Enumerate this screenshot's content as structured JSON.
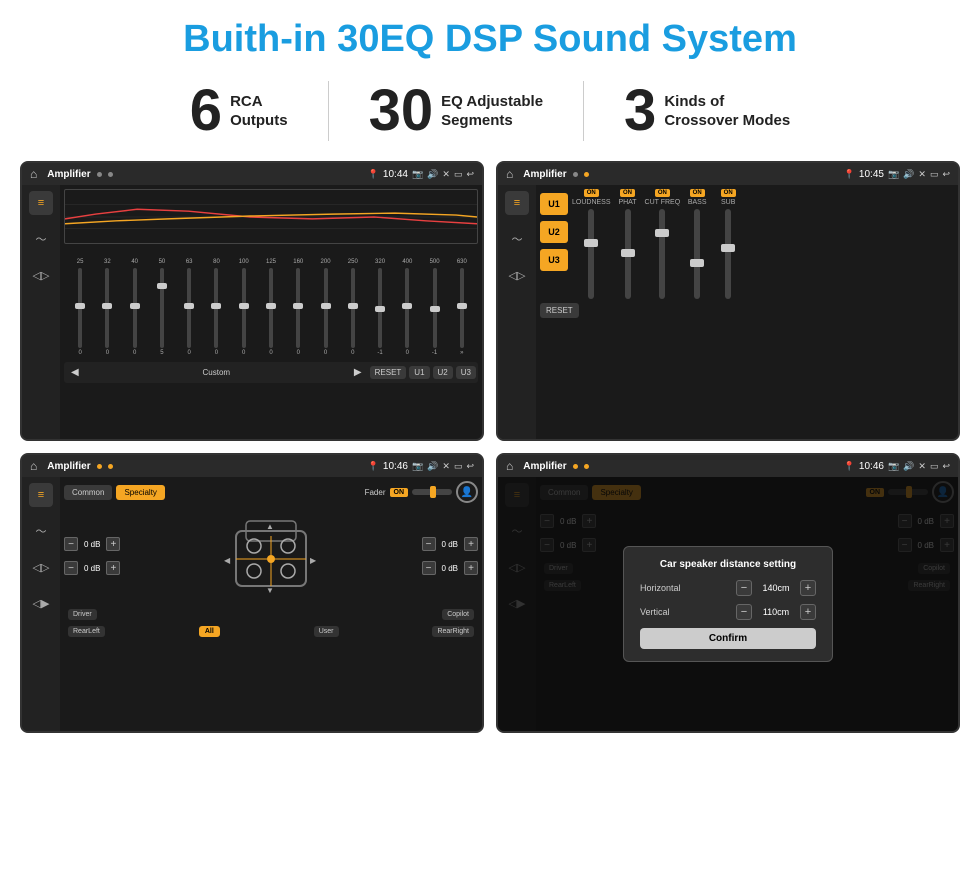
{
  "header": {
    "title": "Buith-in 30EQ DSP Sound System"
  },
  "stats": [
    {
      "number": "6",
      "label": "RCA\nOutputs"
    },
    {
      "number": "30",
      "label": "EQ Adjustable\nSegments"
    },
    {
      "number": "3",
      "label": "Kinds of\nCrossover Modes"
    }
  ],
  "screen1": {
    "topbar_title": "Amplifier",
    "time": "10:44",
    "eq_freqs": [
      "25",
      "32",
      "40",
      "50",
      "63",
      "80",
      "100",
      "125",
      "160",
      "200",
      "250",
      "320",
      "400",
      "500",
      "630"
    ],
    "eq_vals": [
      "0",
      "0",
      "0",
      "5",
      "0",
      "0",
      "0",
      "0",
      "0",
      "0",
      "0",
      "-1",
      "0",
      "-1"
    ],
    "preset": "Custom",
    "buttons": [
      "RESET",
      "U1",
      "U2",
      "U3"
    ]
  },
  "screen2": {
    "topbar_title": "Amplifier",
    "time": "10:45",
    "u_buttons": [
      "U1",
      "U2",
      "U3"
    ],
    "channels": [
      "LOUDNESS",
      "PHAT",
      "CUT FREQ",
      "BASS",
      "SUB"
    ],
    "reset": "RESET"
  },
  "screen3": {
    "topbar_title": "Amplifier",
    "time": "10:46",
    "tabs": [
      "Common",
      "Specialty"
    ],
    "fader_label": "Fader",
    "fader_on": "ON",
    "db_values": [
      "0 dB",
      "0 dB",
      "0 dB",
      "0 dB"
    ],
    "corner_labels": [
      "Driver",
      "Copilot",
      "RearLeft",
      "RearRight"
    ],
    "all_label": "All",
    "user_label": "User"
  },
  "screen4": {
    "topbar_title": "Amplifier",
    "time": "10:46",
    "tabs": [
      "Common",
      "Specialty"
    ],
    "dialog_title": "Car speaker distance setting",
    "horizontal_label": "Horizontal",
    "horizontal_value": "140cm",
    "vertical_label": "Vertical",
    "vertical_value": "110cm",
    "confirm_label": "Confirm",
    "db_values": [
      "0 dB",
      "0 dB"
    ],
    "corner_labels": [
      "Driver",
      "Copilot",
      "RearLeft",
      "RearRight"
    ]
  }
}
